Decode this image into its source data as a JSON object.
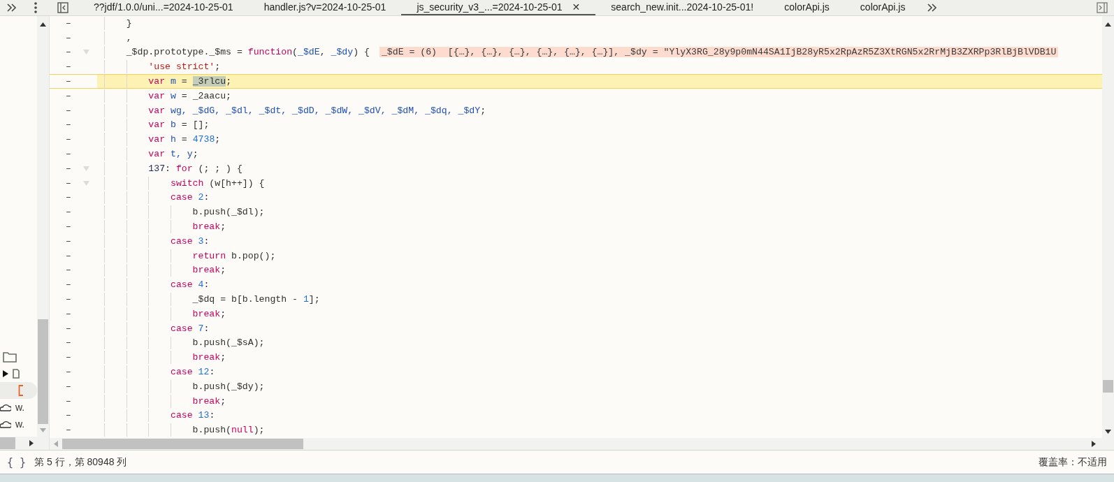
{
  "tabs": [
    {
      "label": "??jdf/1.0.0/uni...=2024-10-25-01",
      "selected": false
    },
    {
      "label": "handler.js?v=2024-10-25-01",
      "selected": false
    },
    {
      "label": "js_security_v3_...=2024-10-25-01",
      "selected": true,
      "close": "✕"
    },
    {
      "label": "search_new.init...2024-10-25-01!",
      "selected": false
    },
    {
      "label": "colorApi.js",
      "selected": false
    },
    {
      "label": "colorApi.js",
      "selected": false
    }
  ],
  "navigator": {
    "items": [
      {
        "kind": "folder",
        "selected": false
      },
      {
        "kind": "file",
        "selected": false
      },
      {
        "kind": "script",
        "selected": true
      },
      {
        "kind": "cloud",
        "label": "w.",
        "selected": false
      },
      {
        "kind": "cloud",
        "label": "w.",
        "selected": false
      }
    ]
  },
  "code": {
    "gutter_mark": "–",
    "lines": [
      {
        "current": false,
        "foldable": false,
        "tokens": [
          {
            "kind": "plain",
            "text": "    }"
          }
        ]
      },
      {
        "current": false,
        "foldable": false,
        "tokens": [
          {
            "kind": "plain",
            "text": "    ,"
          }
        ]
      },
      {
        "current": false,
        "foldable": true,
        "tokens": [
          {
            "kind": "plain",
            "text": "    _$dp.prototype._$ms = "
          },
          {
            "kind": "kw",
            "text": "function"
          },
          {
            "kind": "plain",
            "text": "("
          },
          {
            "kind": "def",
            "text": "_$dE"
          },
          {
            "kind": "plain",
            "text": ", "
          },
          {
            "kind": "def",
            "text": "_$dy"
          },
          {
            "kind": "plain",
            "text": ") {"
          }
        ],
        "annotation": "_$dE = (6)  [{…}, {…}, {…}, {…}, {…}, {…}], _$dy = \"YlyX3RG_28y9p0mN44SA1IjB28yR5x2RpAzR5Z3XtRGN5x2RrMjB3ZXRPp3RlBjBlVDB1U"
      },
      {
        "current": false,
        "foldable": false,
        "tokens": [
          {
            "kind": "str",
            "text": "        'use strict'"
          },
          {
            "kind": "plain",
            "text": ";"
          }
        ]
      },
      {
        "current": true,
        "foldable": false,
        "tokens": [
          {
            "kind": "kw",
            "text": "        var "
          },
          {
            "kind": "def",
            "text": "m"
          },
          {
            "kind": "plain",
            "text": " = "
          },
          {
            "kind": "sel",
            "text": "_3rlcu"
          },
          {
            "kind": "plain",
            "text": ";"
          }
        ]
      },
      {
        "current": false,
        "foldable": false,
        "tokens": [
          {
            "kind": "kw",
            "text": "        var "
          },
          {
            "kind": "def",
            "text": "w"
          },
          {
            "kind": "plain",
            "text": " = _2aacu;"
          }
        ]
      },
      {
        "current": false,
        "foldable": false,
        "tokens": [
          {
            "kind": "kw",
            "text": "        var "
          },
          {
            "kind": "def",
            "text": "wg, _$dG, _$dl, _$dt, _$dD, _$dW, _$dV, _$dM, _$dq, _$dY"
          },
          {
            "kind": "plain",
            "text": ";"
          }
        ]
      },
      {
        "current": false,
        "foldable": false,
        "tokens": [
          {
            "kind": "kw",
            "text": "        var "
          },
          {
            "kind": "def",
            "text": "b"
          },
          {
            "kind": "plain",
            "text": " = [];"
          }
        ]
      },
      {
        "current": false,
        "foldable": false,
        "tokens": [
          {
            "kind": "kw",
            "text": "        var "
          },
          {
            "kind": "def",
            "text": "h"
          },
          {
            "kind": "plain",
            "text": " = "
          },
          {
            "kind": "num",
            "text": "4738"
          },
          {
            "kind": "plain",
            "text": ";"
          }
        ]
      },
      {
        "current": false,
        "foldable": false,
        "tokens": [
          {
            "kind": "kw",
            "text": "        var "
          },
          {
            "kind": "def",
            "text": "t, y"
          },
          {
            "kind": "plain",
            "text": ";"
          }
        ]
      },
      {
        "current": false,
        "foldable": true,
        "tokens": [
          {
            "kind": "label",
            "text": "        137"
          },
          {
            "kind": "plain",
            "text": ": "
          },
          {
            "kind": "kw",
            "text": "for"
          },
          {
            "kind": "plain",
            "text": " (; ; ) {"
          }
        ]
      },
      {
        "current": false,
        "foldable": true,
        "tokens": [
          {
            "kind": "kw",
            "text": "            switch"
          },
          {
            "kind": "plain",
            "text": " (w[h++]) {"
          }
        ]
      },
      {
        "current": false,
        "foldable": false,
        "tokens": [
          {
            "kind": "kw",
            "text": "            case "
          },
          {
            "kind": "num",
            "text": "2"
          },
          {
            "kind": "plain",
            "text": ":"
          }
        ]
      },
      {
        "current": false,
        "foldable": false,
        "tokens": [
          {
            "kind": "plain",
            "text": "                b.push(_$dl);"
          }
        ]
      },
      {
        "current": false,
        "foldable": false,
        "tokens": [
          {
            "kind": "kw",
            "text": "                break"
          },
          {
            "kind": "plain",
            "text": ";"
          }
        ]
      },
      {
        "current": false,
        "foldable": false,
        "tokens": [
          {
            "kind": "kw",
            "text": "            case "
          },
          {
            "kind": "num",
            "text": "3"
          },
          {
            "kind": "plain",
            "text": ":"
          }
        ]
      },
      {
        "current": false,
        "foldable": false,
        "tokens": [
          {
            "kind": "kw",
            "text": "                return"
          },
          {
            "kind": "plain",
            "text": " b.pop();"
          }
        ]
      },
      {
        "current": false,
        "foldable": false,
        "tokens": [
          {
            "kind": "kw",
            "text": "                break"
          },
          {
            "kind": "plain",
            "text": ";"
          }
        ]
      },
      {
        "current": false,
        "foldable": false,
        "tokens": [
          {
            "kind": "kw",
            "text": "            case "
          },
          {
            "kind": "num",
            "text": "4"
          },
          {
            "kind": "plain",
            "text": ":"
          }
        ]
      },
      {
        "current": false,
        "foldable": false,
        "tokens": [
          {
            "kind": "plain",
            "text": "                _$dq = b[b.length - "
          },
          {
            "kind": "num",
            "text": "1"
          },
          {
            "kind": "plain",
            "text": "];"
          }
        ]
      },
      {
        "current": false,
        "foldable": false,
        "tokens": [
          {
            "kind": "kw",
            "text": "                break"
          },
          {
            "kind": "plain",
            "text": ";"
          }
        ]
      },
      {
        "current": false,
        "foldable": false,
        "tokens": [
          {
            "kind": "kw",
            "text": "            case "
          },
          {
            "kind": "num",
            "text": "7"
          },
          {
            "kind": "plain",
            "text": ":"
          }
        ]
      },
      {
        "current": false,
        "foldable": false,
        "tokens": [
          {
            "kind": "plain",
            "text": "                b.push(_$sA);"
          }
        ]
      },
      {
        "current": false,
        "foldable": false,
        "tokens": [
          {
            "kind": "kw",
            "text": "                break"
          },
          {
            "kind": "plain",
            "text": ";"
          }
        ]
      },
      {
        "current": false,
        "foldable": false,
        "tokens": [
          {
            "kind": "kw",
            "text": "            case "
          },
          {
            "kind": "num",
            "text": "12"
          },
          {
            "kind": "plain",
            "text": ":"
          }
        ]
      },
      {
        "current": false,
        "foldable": false,
        "tokens": [
          {
            "kind": "plain",
            "text": "                b.push(_$dy);"
          }
        ]
      },
      {
        "current": false,
        "foldable": false,
        "tokens": [
          {
            "kind": "kw",
            "text": "                break"
          },
          {
            "kind": "plain",
            "text": ";"
          }
        ]
      },
      {
        "current": false,
        "foldable": false,
        "tokens": [
          {
            "kind": "kw",
            "text": "            case "
          },
          {
            "kind": "num",
            "text": "13"
          },
          {
            "kind": "plain",
            "text": ":"
          }
        ]
      },
      {
        "current": false,
        "foldable": false,
        "tokens": [
          {
            "kind": "plain",
            "text": "                b.push("
          },
          {
            "kind": "kw",
            "text": "null"
          },
          {
            "kind": "plain",
            "text": ");"
          }
        ]
      }
    ]
  },
  "status_bar": {
    "braces": "{ }",
    "position": "第 5 行，第 80948 列",
    "coverage": "覆盖率：不适用"
  }
}
